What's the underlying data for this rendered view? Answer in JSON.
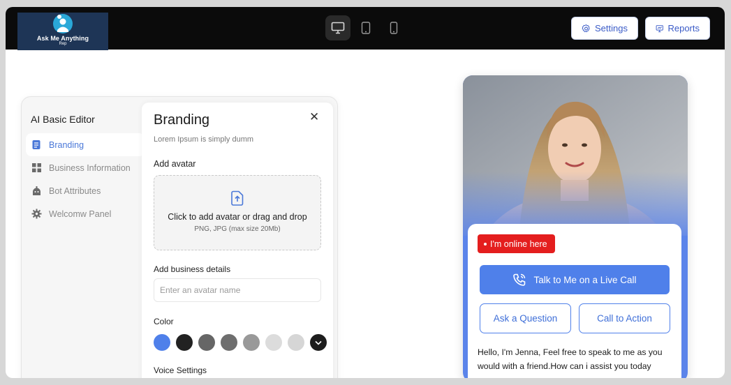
{
  "header": {
    "logo": {
      "title": "Ask Me Anything",
      "subtitle": "Rep"
    },
    "devices": [
      {
        "name": "desktop",
        "active": true
      },
      {
        "name": "tablet",
        "active": false
      },
      {
        "name": "mobile",
        "active": false
      }
    ],
    "settings_label": "Settings",
    "reports_label": "Reports"
  },
  "editor": {
    "title": "AI Basic Editor",
    "nav": [
      {
        "label": "Branding",
        "icon": "branding-icon",
        "active": true
      },
      {
        "label": "Business Information",
        "icon": "grid-icon",
        "active": false
      },
      {
        "label": "Bot Attributes",
        "icon": "bot-icon",
        "active": false
      },
      {
        "label": "Welcomw Panel",
        "icon": "gear-icon",
        "active": false
      }
    ],
    "pane": {
      "title": "Branding",
      "subtitle": "Lorem Ipsum is simply dumm",
      "avatar_label": "Add avatar",
      "dropzone_text": "Click to add avatar or drag and drop",
      "dropzone_hint": "PNG, JPG (max size 20Mb)",
      "business_label": "Add business details",
      "name_placeholder": "Enter an avatar name",
      "color_label": "Color",
      "colors": [
        "#4f80ea",
        "#222222",
        "#666666",
        "#6e6e6e",
        "#999999",
        "#dcdcdc",
        "#d6d6d6"
      ],
      "voice_label": "Voice Settings"
    }
  },
  "preview": {
    "status": "I'm online here",
    "live_call": "Talk to Me on a Live Call",
    "ask": "Ask a Question",
    "cta": "Call to Action",
    "greeting": "Hello, I'm Jenna, Feel free to speak to me as you would with a friend.How can i assist you today"
  }
}
